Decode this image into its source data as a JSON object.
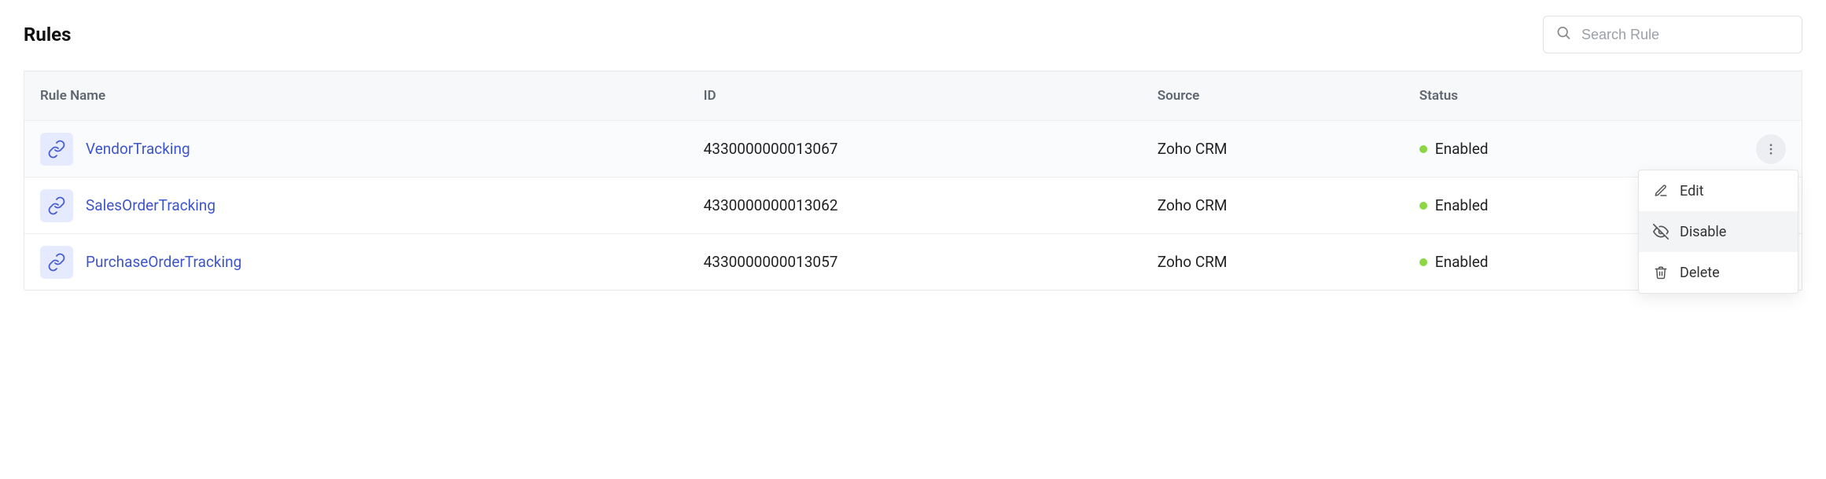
{
  "title": "Rules",
  "search": {
    "placeholder": "Search Rule"
  },
  "columns": {
    "name": "Rule Name",
    "id": "ID",
    "source": "Source",
    "status": "Status"
  },
  "rows": [
    {
      "name": "VendorTracking",
      "id": "4330000000013067",
      "source": "Zoho CRM",
      "status": "Enabled",
      "active": true,
      "show_actions": true
    },
    {
      "name": "SalesOrderTracking",
      "id": "4330000000013062",
      "source": "Zoho CRM",
      "status": "Enabled",
      "active": false,
      "show_actions": false
    },
    {
      "name": "PurchaseOrderTracking",
      "id": "4330000000013057",
      "source": "Zoho CRM",
      "status": "Enabled",
      "active": false,
      "show_actions": false
    }
  ],
  "menu": {
    "edit": "Edit",
    "disable": "Disable",
    "delete": "Delete"
  },
  "colors": {
    "link": "#3e55c9",
    "status_dot": "#8bd742",
    "icon_bg": "#e6eaff"
  }
}
